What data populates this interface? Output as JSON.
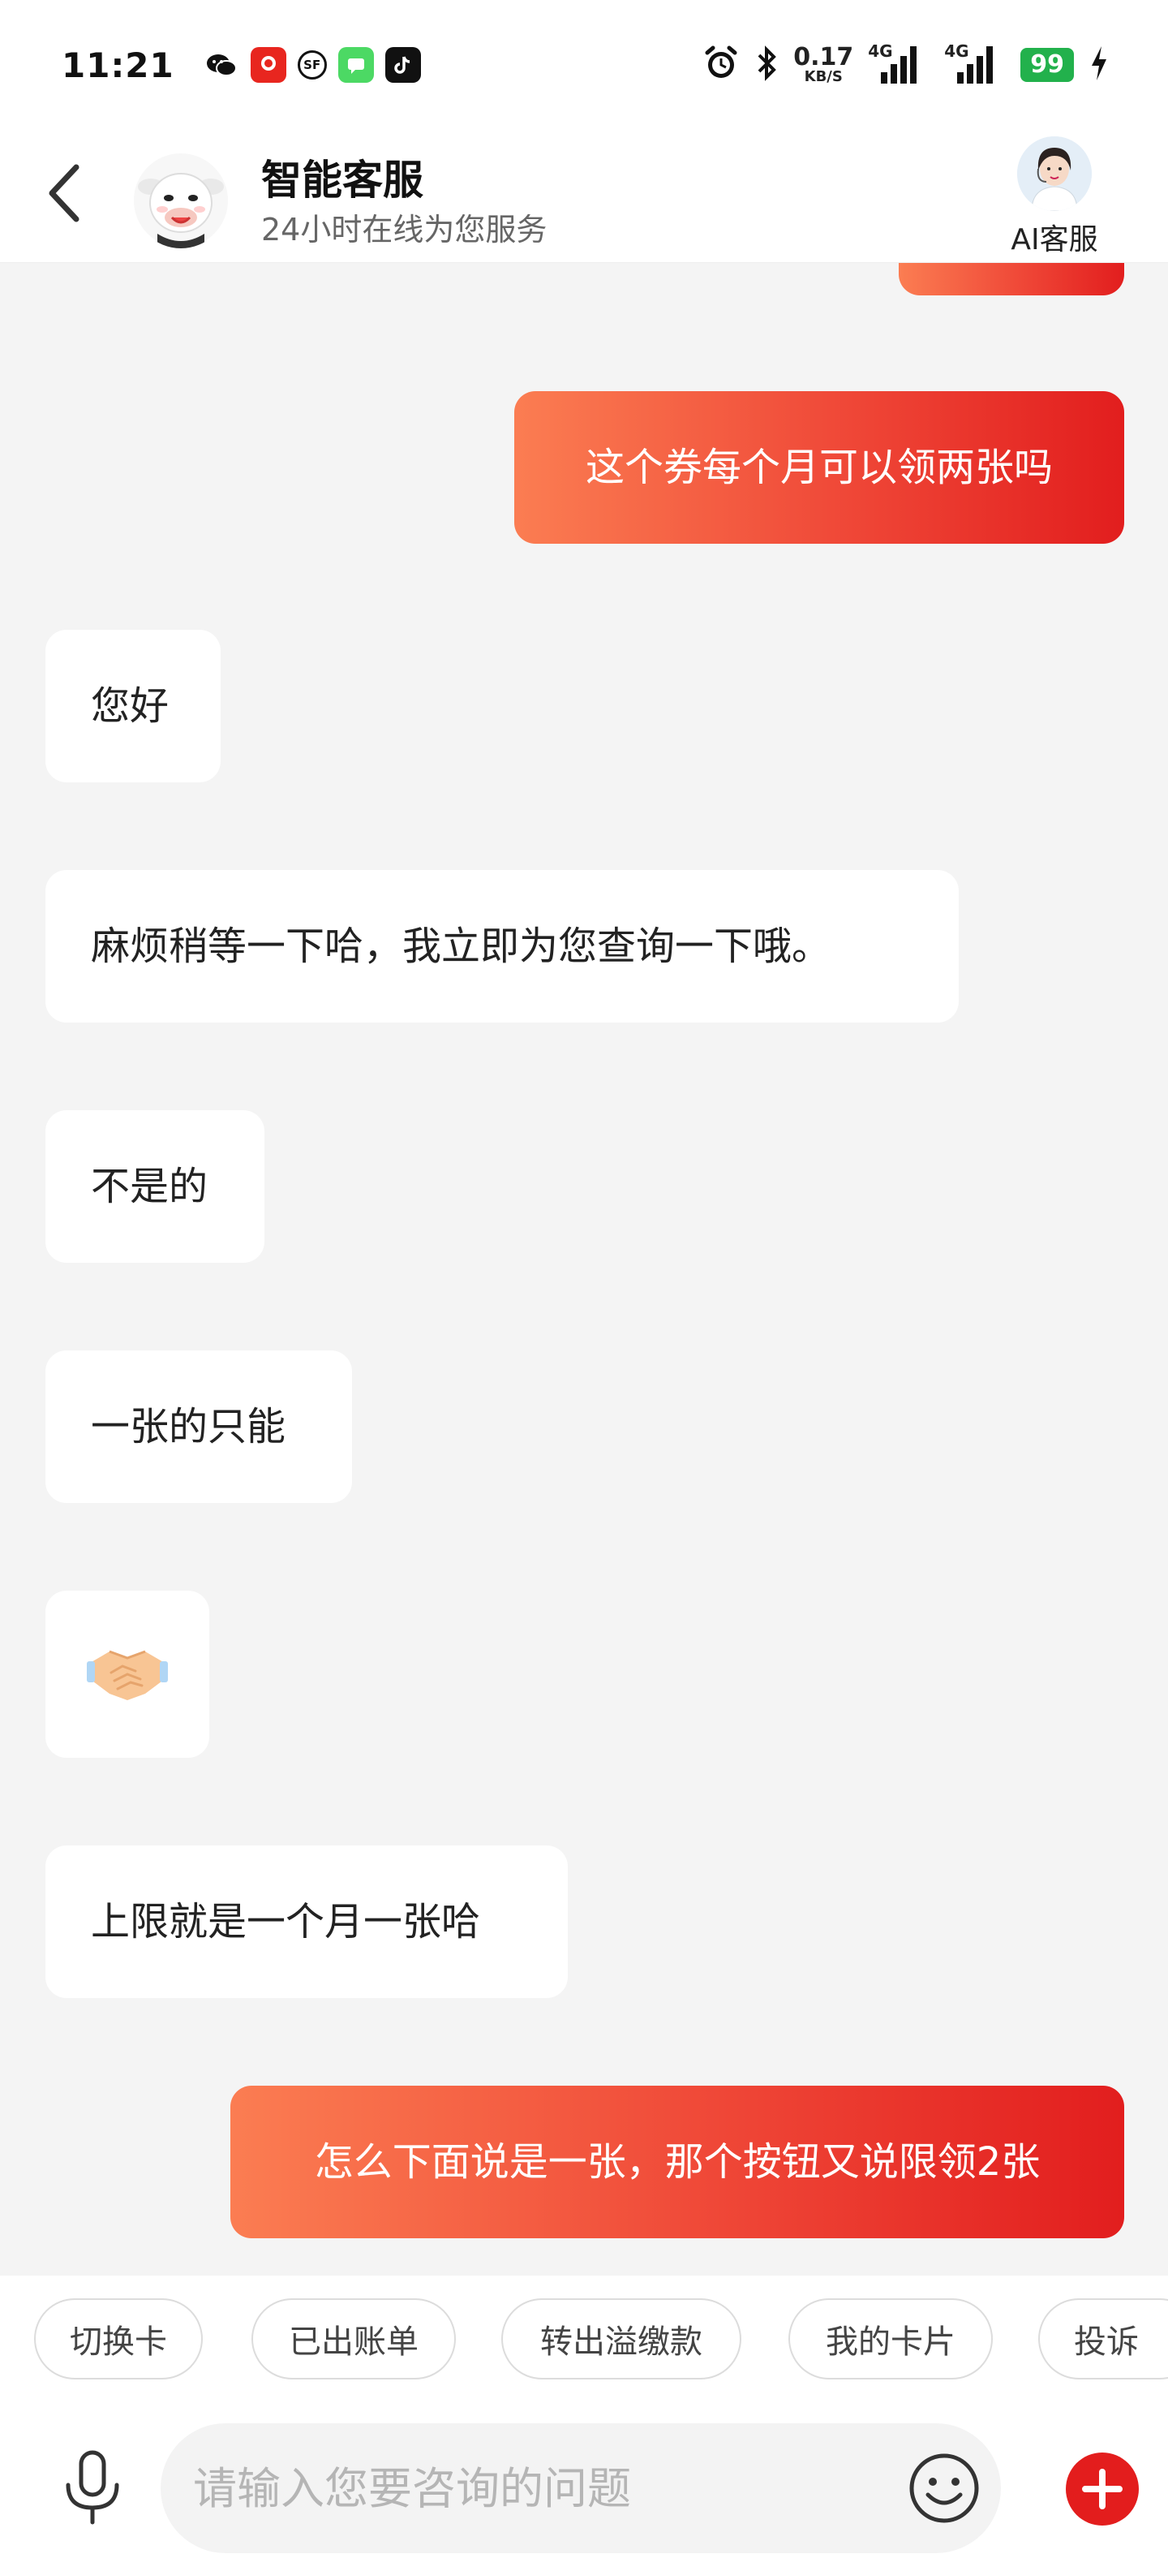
{
  "status_bar": {
    "time": "11:21",
    "net_speed_value": "0.17",
    "net_speed_unit": "KB/S",
    "signal_1_label": "4G",
    "signal_2_label": "4G",
    "battery": "99"
  },
  "header": {
    "title": "智能客服",
    "subtitle": "24小时在线为您服务",
    "ai_service_label": "AI客服"
  },
  "messages": [
    {
      "role": "user",
      "text": ""
    },
    {
      "role": "user",
      "text": "这个券每个月可以领两张吗"
    },
    {
      "role": "agent",
      "text": "您好"
    },
    {
      "role": "agent",
      "text": "麻烦稍等一下哈，我立即为您查询一下哦。"
    },
    {
      "role": "agent",
      "text": "不是的"
    },
    {
      "role": "agent",
      "text": "一张的只能"
    },
    {
      "role": "agent",
      "text": "🤝"
    },
    {
      "role": "agent",
      "text": "上限就是一个月一张哈"
    },
    {
      "role": "user",
      "text": "怎么下面说是一张，那个按钮又说限领2张"
    }
  ],
  "quick_chips": [
    "切换卡",
    "已出账单",
    "转出溢缴款",
    "我的卡片",
    "投诉"
  ],
  "input": {
    "placeholder": "请输入您要咨询的问题",
    "value": ""
  },
  "colors": {
    "user_bubble_start": "#fb7d52",
    "user_bubble_end": "#e21e1e",
    "accent": "#e31d1d",
    "battery": "#22b14c",
    "background": "#f4f4f4"
  }
}
